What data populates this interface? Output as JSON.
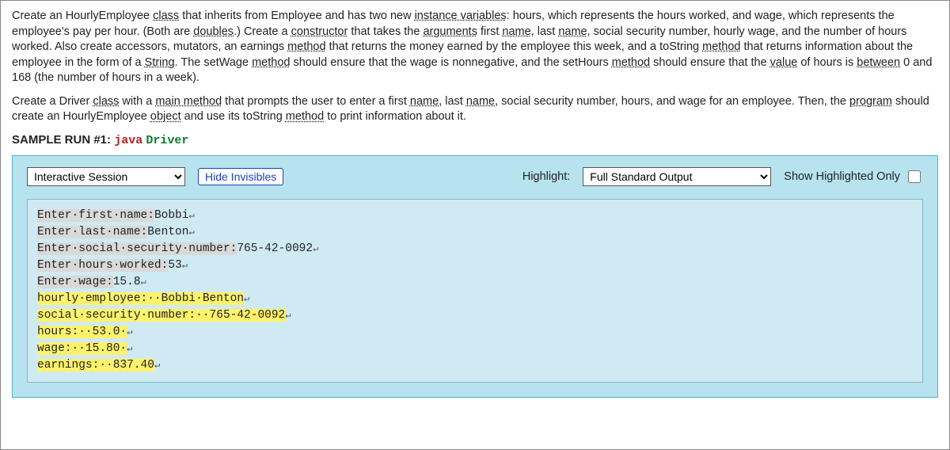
{
  "problem": {
    "para1_parts": [
      {
        "t": "Create an HourlyEmployee "
      },
      {
        "t": "class",
        "u": true
      },
      {
        "t": " that inherits from Employee and has two new "
      },
      {
        "t": "instance variables",
        "u": true
      },
      {
        "t": ": hours, which represents the hours worked, and wage, which represents the employee's pay per hour. (Both are "
      },
      {
        "t": "doubles",
        "u": true
      },
      {
        "t": ".) Create a "
      },
      {
        "t": "constructor",
        "u": true
      },
      {
        "t": " that takes the "
      },
      {
        "t": "arguments",
        "u": true
      },
      {
        "t": " first "
      },
      {
        "t": "name",
        "u": true
      },
      {
        "t": ", last "
      },
      {
        "t": "name",
        "u": true
      },
      {
        "t": ", social security number, hourly wage, and the number of hours worked. Also create accessors, mutators, an earnings "
      },
      {
        "t": "method",
        "u": true
      },
      {
        "t": " that returns the money earned by the employee this week, and a toString "
      },
      {
        "t": "method",
        "u": true
      },
      {
        "t": " that returns information about the employee in the form of a "
      },
      {
        "t": "String",
        "u": true
      },
      {
        "t": ". The setWage "
      },
      {
        "t": "method",
        "u": true
      },
      {
        "t": " should ensure that the wage is nonnegative, and the setHours "
      },
      {
        "t": "method",
        "u": true
      },
      {
        "t": " should ensure that the "
      },
      {
        "t": "value",
        "u": true
      },
      {
        "t": " of hours is "
      },
      {
        "t": "between",
        "u": true
      },
      {
        "t": " 0 and 168 (the number of hours in a week)."
      }
    ],
    "para2_parts": [
      {
        "t": "Create a Driver "
      },
      {
        "t": "class",
        "u": true
      },
      {
        "t": " with a "
      },
      {
        "t": "main method",
        "u": true
      },
      {
        "t": " that prompts the user to enter a first "
      },
      {
        "t": "name",
        "u": true
      },
      {
        "t": ", last "
      },
      {
        "t": "name",
        "u": true
      },
      {
        "t": ", social security number, hours, and wage for an employee. Then, the "
      },
      {
        "t": "program",
        "u": true
      },
      {
        "t": " should create an HourlyEmployee "
      },
      {
        "t": "object",
        "u": true
      },
      {
        "t": " and use its toString "
      },
      {
        "t": "method",
        "u": true
      },
      {
        "t": " to print information about it."
      }
    ]
  },
  "sample_run": {
    "prefix": "SAMPLE RUN #1:",
    "java": "java",
    "driver": "Driver"
  },
  "toolbar": {
    "session_select": "Interactive Session",
    "hide_invisibles": "Hide Invisibles",
    "highlight_label": "Highlight:",
    "highlight_select": "Full Standard Output",
    "show_highlighted": "Show Highlighted Only"
  },
  "terminal": {
    "lines": [
      {
        "segments": [
          {
            "t": "Enter·first·name:",
            "cls": "prompt"
          },
          {
            "t": "Bobbi"
          },
          {
            "t": "↵",
            "cls": "ret"
          }
        ]
      },
      {
        "segments": [
          {
            "t": "Enter·last·name:",
            "cls": "prompt"
          },
          {
            "t": "Benton"
          },
          {
            "t": "↵",
            "cls": "ret"
          }
        ]
      },
      {
        "segments": [
          {
            "t": "Enter·social·security·number:",
            "cls": "prompt"
          },
          {
            "t": "765-42-0092"
          },
          {
            "t": "↵",
            "cls": "ret"
          }
        ]
      },
      {
        "segments": [
          {
            "t": "Enter·hours·worked:",
            "cls": "prompt"
          },
          {
            "t": "53"
          },
          {
            "t": "↵",
            "cls": "ret"
          }
        ]
      },
      {
        "segments": [
          {
            "t": "Enter·wage:",
            "cls": "prompt"
          },
          {
            "t": "15.8"
          },
          {
            "t": "↵",
            "cls": "ret"
          }
        ]
      },
      {
        "segments": [
          {
            "t": "hourly·employee:··Bobbi·Benton",
            "cls": "hl"
          },
          {
            "t": "↵",
            "cls": "ret"
          }
        ]
      },
      {
        "segments": [
          {
            "t": "social·security·number:··765-42-0092",
            "cls": "hl"
          },
          {
            "t": "↵",
            "cls": "ret"
          }
        ]
      },
      {
        "segments": [
          {
            "t": "hours:··53.0·",
            "cls": "hl"
          },
          {
            "t": "↵",
            "cls": "ret"
          }
        ]
      },
      {
        "segments": [
          {
            "t": "wage:··15.80·",
            "cls": "hl"
          },
          {
            "t": "↵",
            "cls": "ret"
          }
        ]
      },
      {
        "segments": [
          {
            "t": "earnings:··837.40",
            "cls": "hl"
          },
          {
            "t": "↵",
            "cls": "ret"
          }
        ]
      }
    ]
  }
}
